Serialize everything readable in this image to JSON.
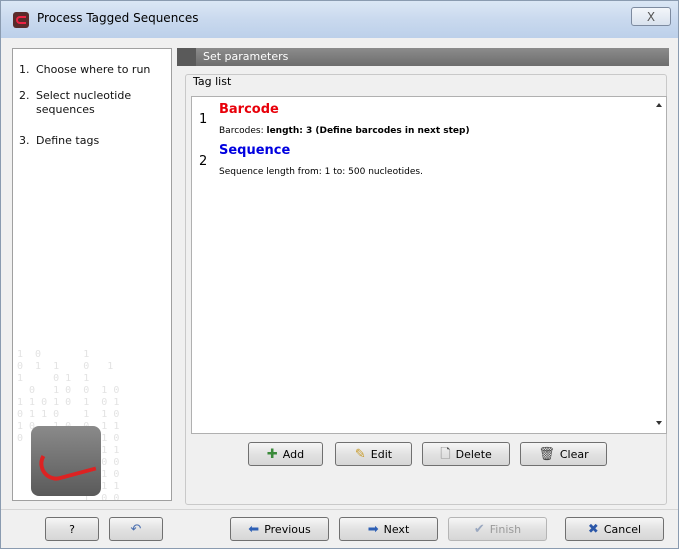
{
  "window": {
    "title": "Process Tagged Sequences",
    "close_label": "X"
  },
  "steps": [
    {
      "num": "1.",
      "label": "Choose where to run"
    },
    {
      "num": "2.",
      "label": "Select nucleotide sequences"
    },
    {
      "num": "3.",
      "label": "Define tags"
    }
  ],
  "panel": {
    "header": "Set parameters",
    "group_label": "Tag list"
  },
  "tags": [
    {
      "num": "1",
      "name": "Barcode",
      "desc_prefix": "Barcodes: ",
      "desc_bold": "length: 3 (Define barcodes in next step)",
      "color": "#e8000a"
    },
    {
      "num": "2",
      "name": "Sequence",
      "desc_prefix": "Sequence length from: 1 to: 500 nucleotides.",
      "desc_bold": "",
      "color": "#0000e0"
    }
  ],
  "list_buttons": {
    "add": "Add",
    "edit": "Edit",
    "delete": "Delete",
    "clear": "Clear"
  },
  "footer": {
    "help": "?",
    "previous": "Previous",
    "next": "Next",
    "finish": "Finish",
    "cancel": "Cancel"
  },
  "icons": {
    "add": "plus-icon",
    "edit": "pencil-icon",
    "delete": "page-delete-icon",
    "clear": "trash-icon",
    "previous": "arrow-left-icon",
    "next": "arrow-right-icon",
    "finish": "checkmark-icon",
    "cancel": "x-icon",
    "reset": "undo-icon"
  }
}
